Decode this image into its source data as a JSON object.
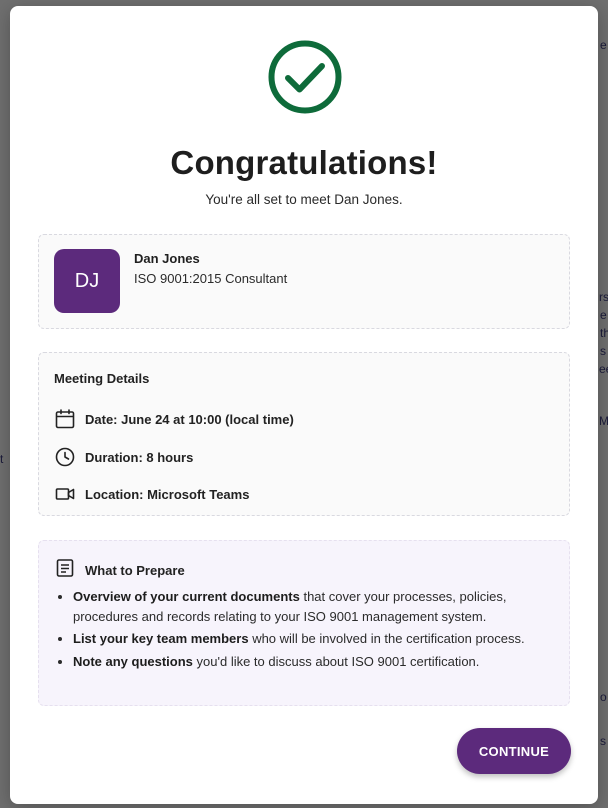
{
  "background_fragments": [
    "e",
    "rs",
    "e",
    "th",
    "s",
    "ee",
    "M",
    "t",
    "o",
    "s"
  ],
  "success": {
    "icon": "check-circle-icon",
    "color": "#0e6b3a",
    "title": "Congratulations!",
    "subtitle": "You're all set to meet Dan Jones."
  },
  "consultant": {
    "initials": "DJ",
    "name": "Dan Jones",
    "role": "ISO 9001:2015 Consultant",
    "avatar_color": "#5c2a7c"
  },
  "meeting": {
    "heading": "Meeting Details",
    "date": "Date: June 24 at 10:00 (local time)",
    "duration": "Duration: 8 hours",
    "location": "Location: Microsoft Teams"
  },
  "prepare": {
    "heading": "What to Prepare",
    "items": [
      {
        "bold": "Overview of your current documents",
        "rest": " that cover your processes, policies, procedures and records relating to your ISO 9001 management system."
      },
      {
        "bold": "List your key team members",
        "rest": " who will be involved in the certification process."
      },
      {
        "bold": "Note any questions",
        "rest": " you'd like to discuss about ISO 9001 certification."
      }
    ]
  },
  "actions": {
    "continue_label": "CONTINUE",
    "accent": "#5c2a7c"
  }
}
